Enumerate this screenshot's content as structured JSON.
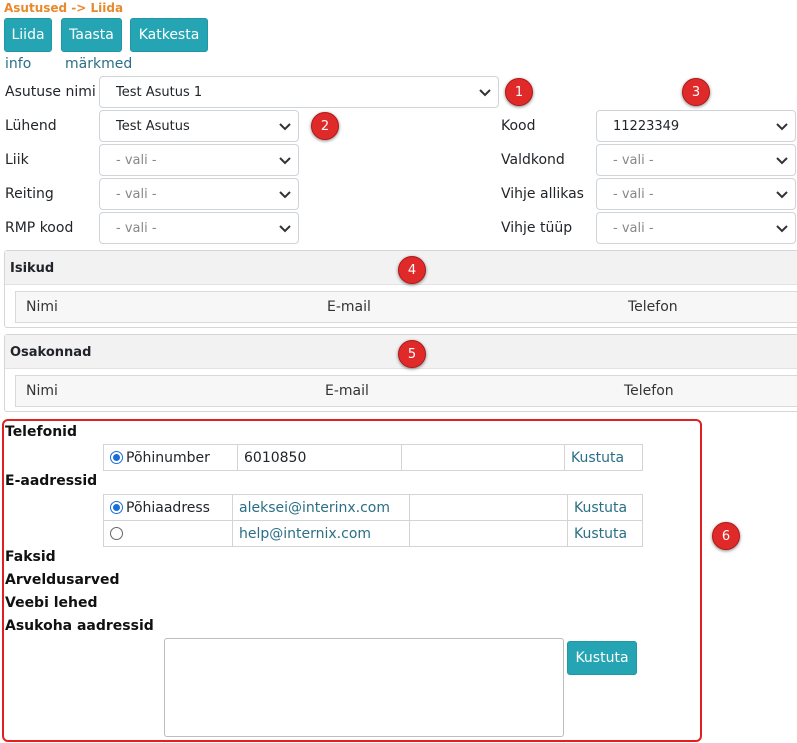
{
  "breadcrumb": "Asutused -> Liida",
  "toolbar": {
    "merge": "Liida",
    "restore": "Taasta",
    "cancel": "Katkesta"
  },
  "tabs": [
    {
      "label": "info"
    },
    {
      "label": "märkmed"
    }
  ],
  "form": {
    "org_name": {
      "label": "Asutuse nimi",
      "value": "Test Asutus 1"
    },
    "short_name": {
      "label": "Lühend",
      "value": "Test Asutus"
    },
    "type": {
      "label": "Liik",
      "value": "- vali -"
    },
    "rating": {
      "label": "Reiting",
      "value": "- vali -"
    },
    "rmp_code": {
      "label": "RMP kood",
      "value": "- vali -"
    },
    "code": {
      "label": "Kood",
      "value": "11223349"
    },
    "domain": {
      "label": "Valdkond",
      "value": "- vali -"
    },
    "hint_source": {
      "label": "Vihje allikas",
      "value": "- vali -"
    },
    "hint_type": {
      "label": "Vihje tüüp",
      "value": "- vali -"
    }
  },
  "markers": [
    "1",
    "2",
    "3",
    "4",
    "5",
    "6"
  ],
  "persons": {
    "title": "Isikud",
    "columns": [
      "Nimi",
      "E-mail",
      "Telefon"
    ]
  },
  "departments": {
    "title": "Osakonnad",
    "columns": [
      "Nimi",
      "E-mail",
      "Telefon"
    ]
  },
  "contacts": {
    "phones_title": "Telefonid",
    "phones": [
      {
        "selected": true,
        "type": "Põhinumber",
        "value": "6010850",
        "extra": "",
        "action": "Kustuta"
      }
    ],
    "emails_title": "E-aadressid",
    "emails": [
      {
        "selected": true,
        "type": "Põhiaadress",
        "value": "aleksei@interinx.com",
        "extra": "",
        "action": "Kustuta"
      },
      {
        "selected": false,
        "type": "",
        "value": "help@internix.com",
        "extra": "",
        "action": "Kustuta"
      }
    ],
    "faxes_title": "Faksid",
    "accounts_title": "Arveldusarved",
    "web_title": "Veebi lehed",
    "addresses_title": "Asukoha aadressid",
    "address_delete": "Kustuta"
  },
  "colors": {
    "accent": "#25a5b3",
    "marker": "#e02a2a",
    "breadcrumb": "#e8892c",
    "highlight_box": "#e02020"
  }
}
